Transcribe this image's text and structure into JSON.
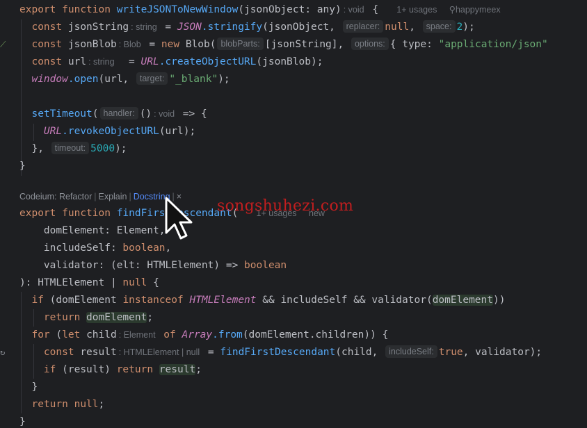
{
  "editor": {
    "block1": {
      "l1": {
        "export": "export",
        "function": "function",
        "name": "writeJSONToNewWindow",
        "params": "(jsonObject: any)",
        "ret_hint": ": void",
        "brace": "{",
        "usages": "1+ usages",
        "author": "happymeex"
      },
      "l2": {
        "const": "const",
        "name": "jsonString",
        "type_hint": ": string",
        "eq": "=",
        "obj": "JSON",
        "call": ".stringify",
        "open": "(jsonObject,",
        "hint_replacer": "replacer:",
        "null": "null",
        "comma": ",",
        "hint_space": "space:",
        "num": "2",
        "close": ");"
      },
      "l3": {
        "const": "const",
        "name": "jsonBlob",
        "type_hint": ": Blob",
        "eq": "=",
        "new": "new",
        "cls": "Blob(",
        "hint_blobParts": "blobParts:",
        "arr": "[jsonString],",
        "hint_options": "options:",
        "opt_open": "{ type:",
        "str": "\"application/json\""
      },
      "l4": {
        "const": "const",
        "name": "url",
        "type_hint": ": string",
        "eq": "=",
        "obj": "URL",
        "call": ".createObjectURL",
        "args": "(jsonBlob);"
      },
      "l5": {
        "obj": "window",
        "call": ".open",
        "args": "(url,",
        "hint_target": "target:",
        "str": "\"_blank\"",
        "close": ");"
      },
      "l7": {
        "call": "setTimeout",
        "open": "(",
        "hint_handler": "handler:",
        "arrow": "()",
        "ret_hint": ": void",
        "arrow2": "=> {"
      },
      "l8": {
        "obj": "URL",
        "call": ".revokeObjectURL",
        "args": "(url);"
      },
      "l9": {
        "close": "},",
        "hint_timeout": "timeout:",
        "num": "5000",
        "end": ");"
      },
      "l10": {
        "brace": "}"
      }
    },
    "codelens": {
      "prefix": "Codeium:",
      "refactor": "Refactor",
      "explain": "Explain",
      "docstring": "Docstring",
      "close": "×"
    },
    "block2": {
      "l1": {
        "export": "export",
        "function": "function",
        "name": "findFirstDescendant",
        "paren": "(",
        "usages": "1+ usages",
        "new": "new"
      },
      "l2": {
        "param": "domElement",
        "colon": ":",
        "type": "Element,",
        "rest": ""
      },
      "l3": {
        "param": "includeSelf",
        "colon": ":",
        "type": "boolean",
        "comma": ","
      },
      "l4": {
        "param": "validator",
        "colon": ":",
        "sig": "(elt: HTMLElement) =>",
        "type": "boolean"
      },
      "l5": {
        "close": "): HTMLElement |",
        "null": "null",
        "brace": "{"
      },
      "l6": {
        "if": "if",
        "open": "(domElement",
        "instanceof": "instanceof",
        "cls": "HTMLElement",
        "rest": "&& includeSelf && validator(",
        "arg": "domElement",
        "close": "))"
      },
      "l7": {
        "return": "return",
        "val": "domElement",
        "semi": ";"
      },
      "l8": {
        "for": "for",
        "open": "(",
        "let": "let",
        "name": "child",
        "type_hint": ": Element",
        "of": "of",
        "obj": "Array",
        "call": ".from",
        "args": "(domElement.children)) {"
      },
      "l9": {
        "const": "const",
        "name": "result",
        "type_hint": ": HTMLElement | null",
        "eq": "=",
        "call": "findFirstDescendant",
        "args": "(child,",
        "hint_includeSelf": "includeSelf:",
        "true": "true",
        "rest": ", validator);"
      },
      "l10": {
        "if": "if",
        "cond": "(result)",
        "return": "return",
        "val": "result",
        "semi": ";"
      },
      "l11": {
        "brace": "}"
      },
      "l12": {
        "return": "return",
        "null": "null",
        "semi": ";"
      },
      "l13": {
        "brace": "}"
      }
    },
    "gutter": {
      "mark1": "⟋",
      "mark2": "↻"
    }
  },
  "watermark": "songshuhezi.com",
  "colors": {
    "background": "#1e1f22",
    "keyword": "#cf8e6d",
    "function": "#56a8f5",
    "string": "#6aab73",
    "number": "#2aacb8",
    "global": "#c77dbb",
    "watermark": "#e61e1e",
    "link": "#548af7"
  }
}
